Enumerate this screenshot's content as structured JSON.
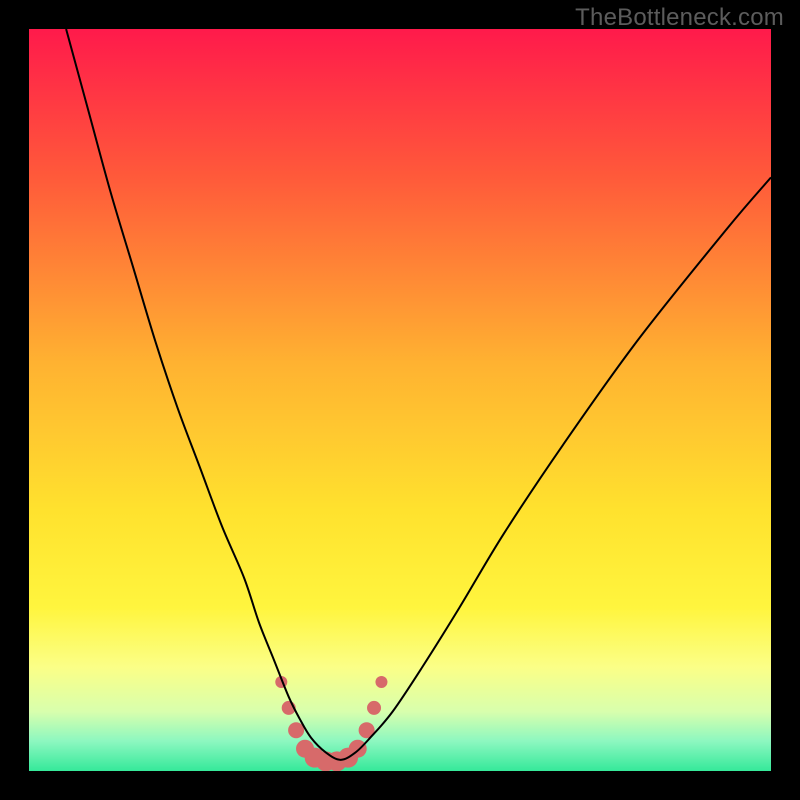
{
  "watermark": {
    "text": "TheBottleneck.com"
  },
  "chart_data": {
    "type": "line",
    "title": "",
    "xlabel": "",
    "ylabel": "",
    "xlim": [
      0,
      100
    ],
    "ylim": [
      0,
      100
    ],
    "grid": false,
    "legend": false,
    "background_gradient": {
      "stops": [
        {
          "offset": 0.0,
          "color": "#ff1a4b"
        },
        {
          "offset": 0.2,
          "color": "#ff5a3a"
        },
        {
          "offset": 0.45,
          "color": "#ffb231"
        },
        {
          "offset": 0.65,
          "color": "#ffe22e"
        },
        {
          "offset": 0.78,
          "color": "#fff53e"
        },
        {
          "offset": 0.86,
          "color": "#fbff87"
        },
        {
          "offset": 0.92,
          "color": "#d8ffad"
        },
        {
          "offset": 0.96,
          "color": "#8cf7c0"
        },
        {
          "offset": 1.0,
          "color": "#35e99a"
        }
      ]
    },
    "series": [
      {
        "name": "curve",
        "color": "#000000",
        "width": 2,
        "x": [
          5,
          8,
          11,
          14,
          17,
          20,
          23,
          26,
          29,
          31,
          33,
          35,
          36.5,
          38,
          40,
          42,
          44,
          46,
          49,
          53,
          58,
          64,
          72,
          82,
          94,
          100
        ],
        "y": [
          100,
          89,
          78,
          68,
          58,
          49,
          41,
          33,
          26,
          20,
          15,
          10,
          7,
          4.5,
          2.5,
          1.5,
          2.5,
          4.5,
          8,
          14,
          22,
          32,
          44,
          58,
          73,
          80
        ]
      }
    ],
    "markers": {
      "name": "bottom-cluster",
      "color": "#d76a6a",
      "radius_range": [
        5,
        11
      ],
      "points": [
        {
          "x": 34.0,
          "y": 12.0,
          "r": 6
        },
        {
          "x": 35.0,
          "y": 8.5,
          "r": 7
        },
        {
          "x": 36.0,
          "y": 5.5,
          "r": 8
        },
        {
          "x": 37.2,
          "y": 3.0,
          "r": 9
        },
        {
          "x": 38.5,
          "y": 1.8,
          "r": 10
        },
        {
          "x": 40.0,
          "y": 1.3,
          "r": 10
        },
        {
          "x": 41.5,
          "y": 1.3,
          "r": 10
        },
        {
          "x": 43.0,
          "y": 1.8,
          "r": 10
        },
        {
          "x": 44.3,
          "y": 3.0,
          "r": 9
        },
        {
          "x": 45.5,
          "y": 5.5,
          "r": 8
        },
        {
          "x": 46.5,
          "y": 8.5,
          "r": 7
        },
        {
          "x": 47.5,
          "y": 12.0,
          "r": 6
        }
      ]
    }
  }
}
